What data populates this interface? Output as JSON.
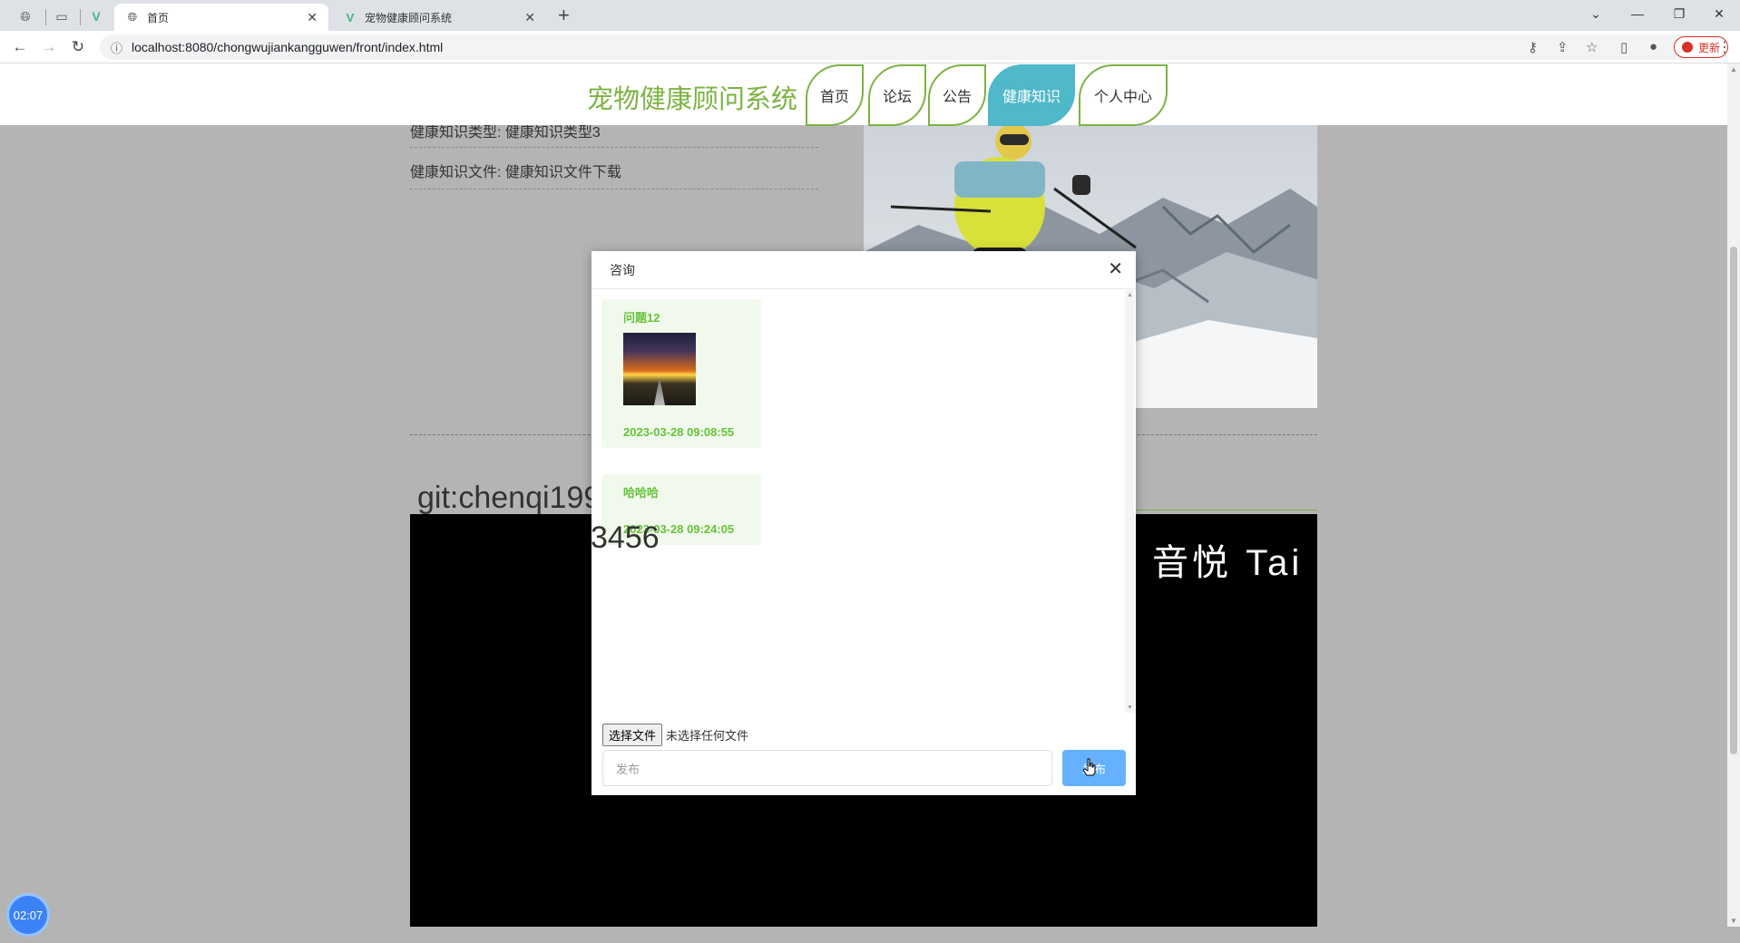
{
  "browser": {
    "tabs": [
      {
        "label": "首页",
        "icon": "globe-icon",
        "active": true
      },
      {
        "label": "宠物健康顾问系统",
        "icon": "vue-logo-icon",
        "active": false
      }
    ],
    "url": "localhost:8080/chongwujiankangguwen/front/index.html",
    "update_label": "更新"
  },
  "header": {
    "site_title": "宠物健康顾问系统",
    "nav": [
      {
        "label": "首页",
        "active": false
      },
      {
        "label": "论坛",
        "active": false
      },
      {
        "label": "公告",
        "active": false
      },
      {
        "label": "健康知识",
        "active": true
      },
      {
        "label": "个人中心",
        "active": false
      }
    ]
  },
  "page": {
    "info_type": "健康知识类型: 健康知识类型3",
    "info_file": "健康知识文件: 健康知识文件下载",
    "git_text_1": "git:chenqi199",
    "git_text_2": "3456",
    "watermark": "音悦 Tai"
  },
  "dialog": {
    "title": "咨询",
    "messages": [
      {
        "text": "问题12",
        "has_image": true,
        "time": "2023-03-28 09:08:55"
      },
      {
        "text": "哈哈哈",
        "has_image": false,
        "time": "2023-03-28 09:24:05"
      }
    ],
    "file_button": "选择文件",
    "file_status": "未选择任何文件",
    "input_placeholder": "发布",
    "submit_label": "发布"
  },
  "timer": "02:07",
  "colors": {
    "brand_green": "#7cb342",
    "nav_active": "#4fb8c9",
    "bubble_bg": "#f0f9eb",
    "bubble_text": "#67c23a",
    "primary_button": "#66b1ff"
  }
}
